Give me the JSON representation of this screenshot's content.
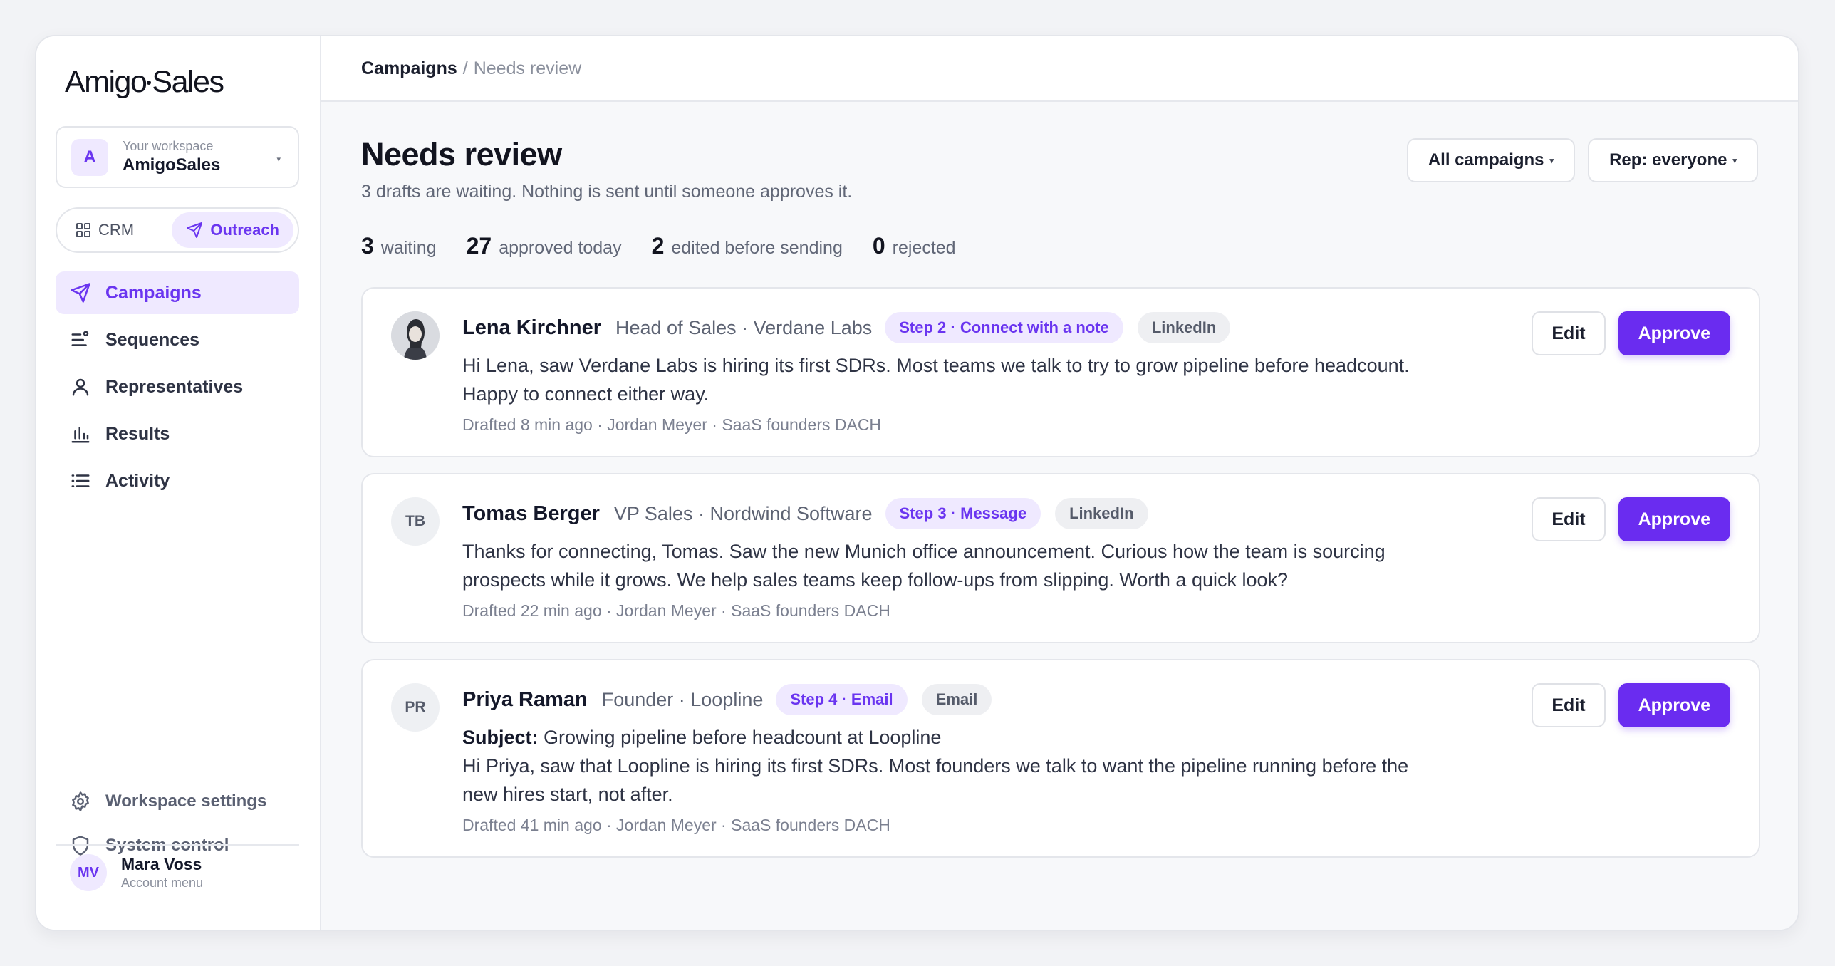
{
  "brand": {
    "logo_left": "Amigo",
    "logo_right": "Sales",
    "accent": "#6a2cf0"
  },
  "workspace": {
    "avatar": "A",
    "label": "Your workspace",
    "name": "AmigoSales",
    "caret": "▾"
  },
  "mode_switch": {
    "crm": "CRM",
    "outreach": "Outreach",
    "active": "Outreach"
  },
  "nav": {
    "items": [
      {
        "label": "Campaigns",
        "icon": "send-icon",
        "active": true
      },
      {
        "label": "Sequences",
        "icon": "sequence-icon"
      },
      {
        "label": "Representatives",
        "icon": "user-icon"
      },
      {
        "label": "Results",
        "icon": "bar-chart-icon"
      },
      {
        "label": "Activity",
        "icon": "list-icon"
      }
    ]
  },
  "bottom_nav": {
    "settings": "Workspace settings",
    "system": "System control"
  },
  "user": {
    "initials": "MV",
    "name": "Mara Voss",
    "sub": "Account menu"
  },
  "breadcrumb": {
    "main": "Campaigns",
    "sep": "/",
    "sub": "Needs review"
  },
  "page": {
    "title": "Needs review",
    "subtitle": "3 drafts are waiting. Nothing is sent until someone approves it."
  },
  "filters": {
    "campaigns": "All campaigns",
    "rep": "Rep: everyone",
    "caret": "▾"
  },
  "stats": [
    {
      "num": "3",
      "label": "waiting"
    },
    {
      "num": "27",
      "label": "approved today"
    },
    {
      "num": "2",
      "label": "edited before sending"
    },
    {
      "num": "0",
      "label": "rejected"
    }
  ],
  "actions": {
    "edit": "Edit",
    "approve": "Approve"
  },
  "drafts": [
    {
      "initials": "",
      "has_photo": true,
      "name": "Lena Kirchner",
      "role": "Head of Sales · Verdane Labs",
      "step": "Step 2 · Connect with a note",
      "channel": "LinkedIn",
      "subject_label": "",
      "subject": "",
      "body": "Hi Lena, saw Verdane Labs is hiring its first SDRs. Most teams we talk to try to grow pipeline before headcount. Happy to connect either way.",
      "meta": "Drafted 8 min ago · Jordan Meyer · SaaS founders DACH"
    },
    {
      "initials": "TB",
      "name": "Tomas Berger",
      "role": "VP Sales · Nordwind Software",
      "step": "Step 3 · Message",
      "channel": "LinkedIn",
      "subject_label": "",
      "subject": "",
      "body": "Thanks for connecting, Tomas. Saw the new Munich office announcement. Curious how the team is sourcing prospects while it grows. We help sales teams keep follow-ups from slipping. Worth a quick look?",
      "meta": "Drafted 22 min ago · Jordan Meyer · SaaS founders DACH"
    },
    {
      "initials": "PR",
      "name": "Priya Raman",
      "role": "Founder · Loopline",
      "step": "Step 4 · Email",
      "channel": "Email",
      "subject_label": "Subject:",
      "subject": "Growing pipeline before headcount at Loopline",
      "body": "Hi Priya, saw that Loopline is hiring its first SDRs. Most founders we talk to want the pipeline running before the new hires start, not after.",
      "meta": "Drafted 41 min ago · Jordan Meyer · SaaS founders DACH"
    }
  ]
}
